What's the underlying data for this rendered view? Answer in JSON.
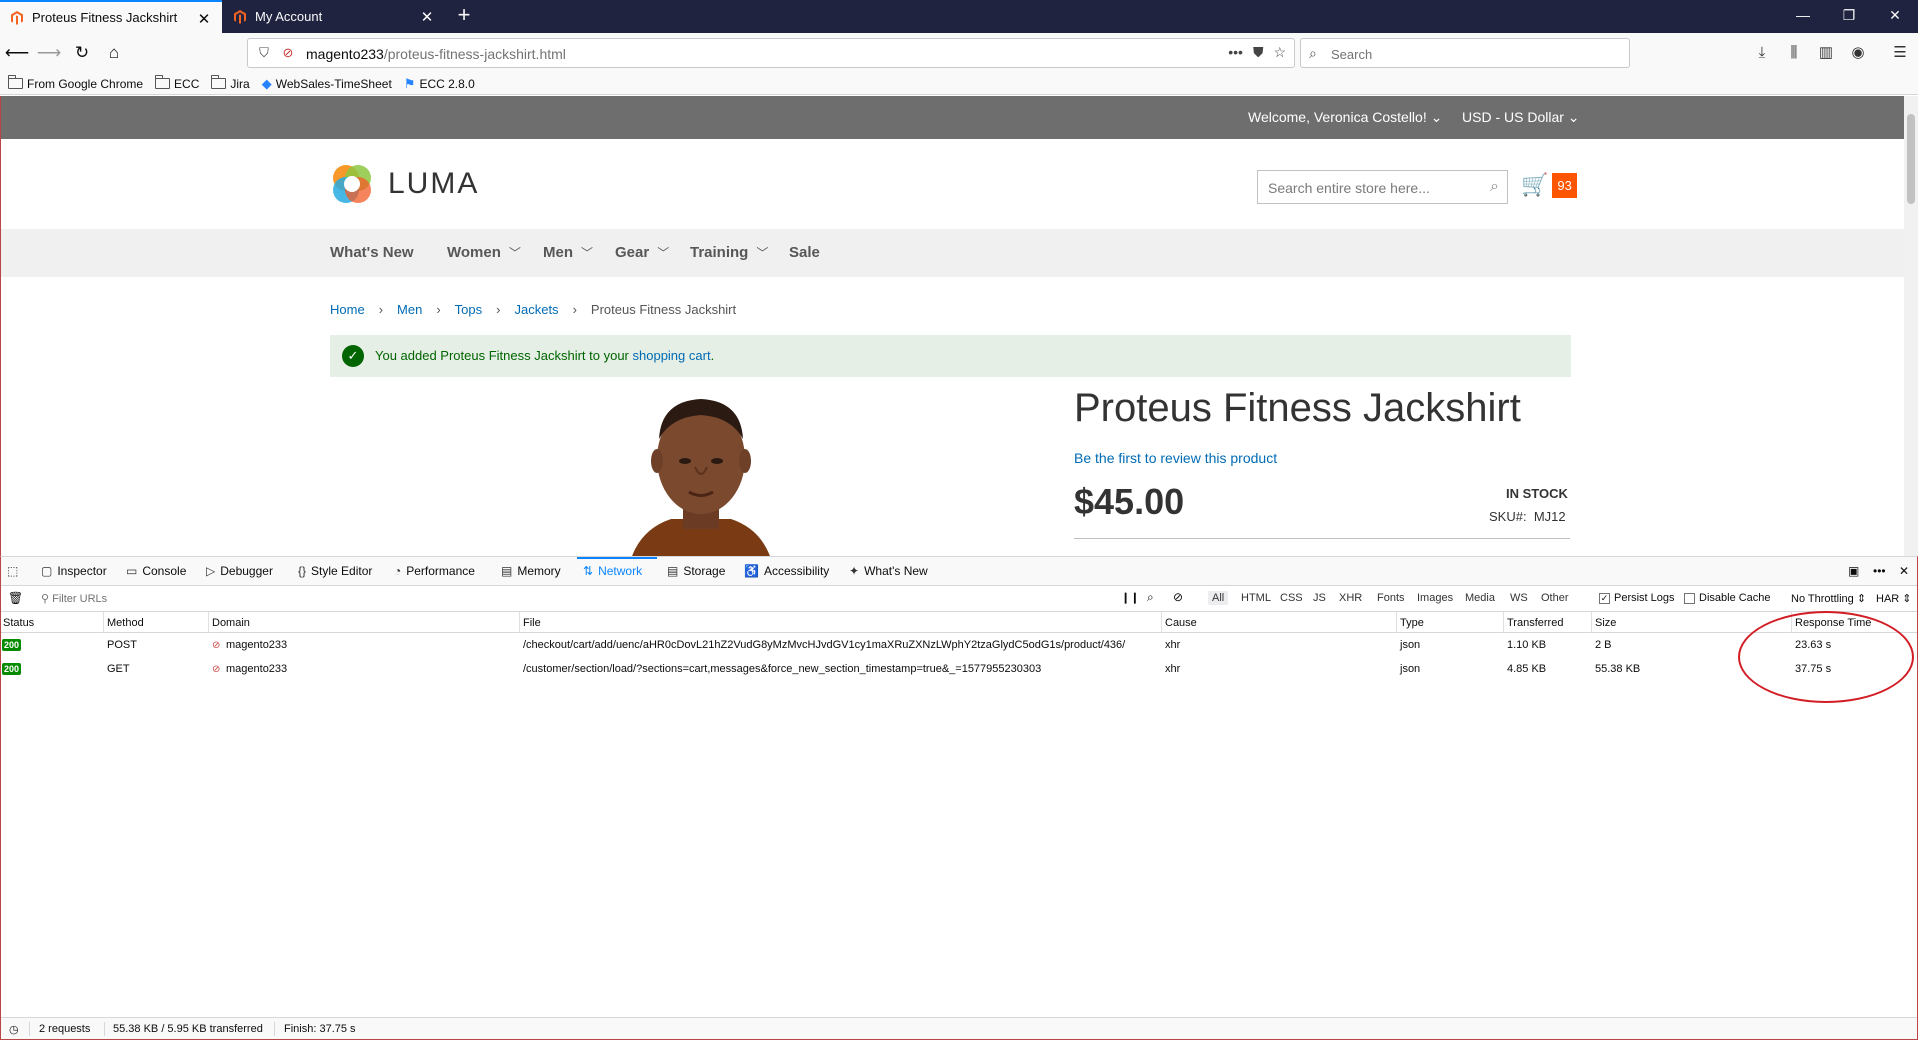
{
  "browser": {
    "tabs": [
      {
        "title": "Proteus Fitness Jackshirt",
        "active": true
      },
      {
        "title": "My Account",
        "active": false
      }
    ],
    "url": {
      "host": "magento233",
      "path": "/proteus-fitness-jackshirt.html"
    },
    "search_placeholder": "Search",
    "bookmarks": [
      {
        "label": "From Google Chrome",
        "icon": "folder-icon"
      },
      {
        "label": "ECC",
        "icon": "folder-icon"
      },
      {
        "label": "Jira",
        "icon": "folder-icon"
      },
      {
        "label": "WebSales-TimeSheet",
        "icon": "jira-diamond-icon"
      },
      {
        "label": "ECC 2.8.0",
        "icon": "app-icon"
      }
    ]
  },
  "store": {
    "welcome": "Welcome, Veronica Costello!",
    "currency": "USD - US Dollar",
    "logo_text": "LUMA",
    "search_placeholder": "Search entire store here...",
    "cart_count": "93",
    "menu": [
      "What's New",
      "Women",
      "Men",
      "Gear",
      "Training",
      "Sale"
    ],
    "breadcrumbs": [
      "Home",
      "Men",
      "Tops",
      "Jackets"
    ],
    "breadcrumb_current": "Proteus Fitness Jackshirt",
    "message_prefix": "You added Proteus Fitness Jackshirt to your ",
    "message_link": "shopping cart",
    "message_suffix": ".",
    "product": {
      "title": "Proteus Fitness Jackshirt",
      "review_link": "Be the first to review this product",
      "price": "$45.00",
      "stock": "IN STOCK",
      "sku_label": "SKU#:",
      "sku": "MJ12"
    }
  },
  "devtools": {
    "tabs": [
      "Inspector",
      "Console",
      "Debugger",
      "Style Editor",
      "Performance",
      "Memory",
      "Network",
      "Storage",
      "Accessibility",
      "What's New"
    ],
    "active_tab": "Network",
    "filter_placeholder": "Filter URLs",
    "type_filters": [
      "All",
      "HTML",
      "CSS",
      "JS",
      "XHR",
      "Fonts",
      "Images",
      "Media",
      "WS",
      "Other"
    ],
    "persist_logs": "Persist Logs",
    "disable_cache": "Disable Cache",
    "throttling": "No Throttling",
    "har": "HAR",
    "columns": [
      "Status",
      "Method",
      "Domain",
      "File",
      "Cause",
      "Type",
      "Transferred",
      "Size",
      "Response Time"
    ],
    "requests": [
      {
        "status": "200",
        "method": "POST",
        "domain": "magento233",
        "file": "/checkout/cart/add/uenc/aHR0cDovL21hZ2VudG8yMzMvcHJvdGV1cy1maXRuZXNzLWphY2tzaGlydC5odG1s/product/436/",
        "cause": "xhr",
        "type": "json",
        "transferred": "1.10 KB",
        "size": "2 B",
        "response_time": "23.63 s"
      },
      {
        "status": "200",
        "method": "GET",
        "domain": "magento233",
        "file": "/customer/section/load/?sections=cart,messages&force_new_section_timestamp=true&_=1577955230303",
        "cause": "xhr",
        "type": "json",
        "transferred": "4.85 KB",
        "size": "55.38 KB",
        "response_time": "37.75 s"
      }
    ],
    "status_bar": {
      "requests": "2 requests",
      "transferred": "55.38 KB / 5.95 KB transferred",
      "finish": "Finish: 37.75 s"
    }
  },
  "colors": {
    "tabbar": "#202340",
    "accent": "#0a84ff",
    "status_ok": "#058b00",
    "cart_badge": "#ff5501",
    "annotation": "#d21d25"
  }
}
